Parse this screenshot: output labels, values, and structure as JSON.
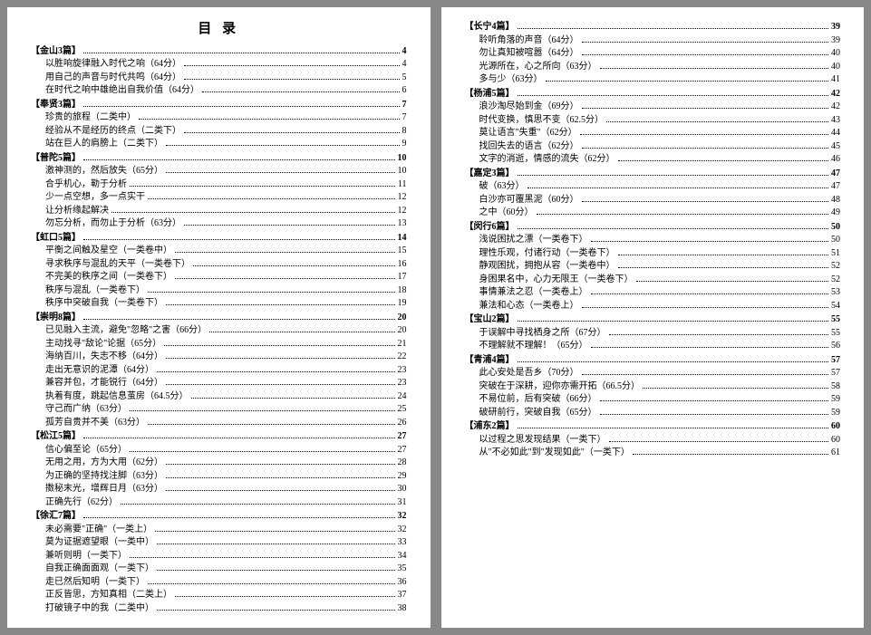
{
  "title": "目 录",
  "leftSections": [
    {
      "name": "金山3篇",
      "page": "4",
      "items": [
        {
          "t": "以胜响旋律融入时代之响（64分）",
          "p": "4"
        },
        {
          "t": "用自己的声音与时代共鸣（64分）",
          "p": "5"
        },
        {
          "t": "在时代之响中雄绝出自我价值（64分）",
          "p": "6"
        }
      ]
    },
    {
      "name": "奉贤3篇",
      "page": "7",
      "items": [
        {
          "t": "珍贵的旅程（二类中）",
          "p": "7"
        },
        {
          "t": "经验从不是经历的终点（二类下）",
          "p": "8"
        },
        {
          "t": "站在巨人的肩膀上（二类下）",
          "p": "9"
        }
      ]
    },
    {
      "name": "普陀5篇",
      "page": "10",
      "items": [
        {
          "t": "激神测的，然后放失（65分）",
          "p": "10"
        },
        {
          "t": "合乎机心，勒于分析",
          "p": "11"
        },
        {
          "t": "少一点空想，多一点实干",
          "p": "12"
        },
        {
          "t": "让分析缘起解决",
          "p": "12"
        },
        {
          "t": "勿忘分析，而勿止于分析（63分）",
          "p": "13"
        }
      ]
    },
    {
      "name": "虹口5篇",
      "page": "14",
      "items": [
        {
          "t": "平衡之间触及星空（一类卷中）",
          "p": "15"
        },
        {
          "t": "寻求秩序与混乱的天平（一类卷下）",
          "p": "16"
        },
        {
          "t": "不完美的秩序之间（一类卷下）",
          "p": "17"
        },
        {
          "t": "秩序与混乱（一类卷下）",
          "p": "18"
        },
        {
          "t": "秩序中突破自我（一类卷下）",
          "p": "19"
        }
      ]
    },
    {
      "name": "崇明8篇",
      "page": "20",
      "items": [
        {
          "t": "已见融入主流，避免\"忽略\"之害（66分）",
          "p": "20"
        },
        {
          "t": "主动找寻\"敌论\"论据（65分）",
          "p": "21"
        },
        {
          "t": "海纳百川，失志不移（64分）",
          "p": "22"
        },
        {
          "t": "走出无意识的泥潭（64分）",
          "p": "23"
        },
        {
          "t": "兼容并包，才能锐行（64分）",
          "p": "23"
        },
        {
          "t": "执着有度，跳起信息茧房（64.5分）",
          "p": "24"
        },
        {
          "t": "守己而广纳（63分）",
          "p": "25"
        },
        {
          "t": "孤芳自贵并不美（63分）",
          "p": "26"
        }
      ]
    },
    {
      "name": "松江5篇",
      "page": "27",
      "items": [
        {
          "t": "信心偏至论（65分）",
          "p": "27"
        },
        {
          "t": "无用之用，方为大用（62分）",
          "p": "28"
        },
        {
          "t": "为正确的坚持找注脚（63分）",
          "p": "29"
        },
        {
          "t": "擞秘末光，增辉日月（63分）",
          "p": "30"
        },
        {
          "t": "正确先行（62分）",
          "p": "31"
        }
      ]
    },
    {
      "name": "徐汇7篇",
      "page": "32",
      "items": [
        {
          "t": "未必需要\"正确\"（一类上）",
          "p": "32"
        },
        {
          "t": "莫为证据遮望眼（一类中）",
          "p": "33"
        },
        {
          "t": "兼听则明（一类下）",
          "p": "34"
        },
        {
          "t": "自我正确面面观（一类下）",
          "p": "35"
        },
        {
          "t": "走已然后知明（一类下）",
          "p": "36"
        },
        {
          "t": "正反皆思，方知真相（二类上）",
          "p": "37"
        },
        {
          "t": "打破镜子中的我（二类中）",
          "p": "38"
        }
      ]
    }
  ],
  "rightSections": [
    {
      "name": "长宁4篇",
      "page": "39",
      "items": [
        {
          "t": "聆听角落的声音（64分）",
          "p": "39"
        },
        {
          "t": "勿让真知被喧嚣（64分）",
          "p": "40"
        },
        {
          "t": "光源所在，心之所向（63分）",
          "p": "40"
        },
        {
          "t": "多与少（63分）",
          "p": "41"
        }
      ]
    },
    {
      "name": "杨浦5篇",
      "page": "42",
      "items": [
        {
          "t": "浪沙淘尽始到金（69分）",
          "p": "42"
        },
        {
          "t": "时代变换，慎思不变（62.5分）",
          "p": "43"
        },
        {
          "t": "莫让语言\"失重\"（62分）",
          "p": "44"
        },
        {
          "t": "找回失去的语言（62分）",
          "p": "45"
        },
        {
          "t": "文字的消逝，情感的流失（62分）",
          "p": "46"
        }
      ]
    },
    {
      "name": "嘉定3篇",
      "page": "47",
      "items": [
        {
          "t": "破（63分）",
          "p": "47"
        },
        {
          "t": "白沙亦可覆黑泥（60分）",
          "p": "48"
        },
        {
          "t": "之中（60分）",
          "p": "49"
        }
      ]
    },
    {
      "name": "闵行6篇",
      "page": "50",
      "items": [
        {
          "t": "浅说困扰之漂（一类卷下）",
          "p": "50"
        },
        {
          "t": "理性乐观，付诸行动（一类卷下）",
          "p": "51"
        },
        {
          "t": "静观困扰，拥抱从容（一类卷中）",
          "p": "52"
        },
        {
          "t": "身困果名中，心力无限王（一类卷下）",
          "p": "52"
        },
        {
          "t": "事情兼法之忍（一类卷上）",
          "p": "53"
        },
        {
          "t": "兼法和心态（一类卷上）",
          "p": "54"
        }
      ]
    },
    {
      "name": "宝山2篇",
      "page": "55",
      "items": [
        {
          "t": "于误解中寻找栖身之所（67分）",
          "p": "55"
        },
        {
          "t": "不理解就不理解！（65分）",
          "p": "56"
        }
      ]
    },
    {
      "name": "青浦4篇",
      "page": "57",
      "items": [
        {
          "t": "此心安处是吾乡（70分）",
          "p": "57"
        },
        {
          "t": "突破在于深耕，迎你亦需开拓（66.5分）",
          "p": "58"
        },
        {
          "t": "不易位前，后有突破（66分）",
          "p": "59"
        },
        {
          "t": "破研前行，突破自我（65分）",
          "p": "59"
        }
      ]
    },
    {
      "name": "浦东2篇",
      "page": "60",
      "items": [
        {
          "t": "以过程之思发现结果（一类下）",
          "p": "60"
        },
        {
          "t": "从\"不必如此\"到\"发现如此\"（一类下）",
          "p": "61"
        }
      ]
    }
  ]
}
